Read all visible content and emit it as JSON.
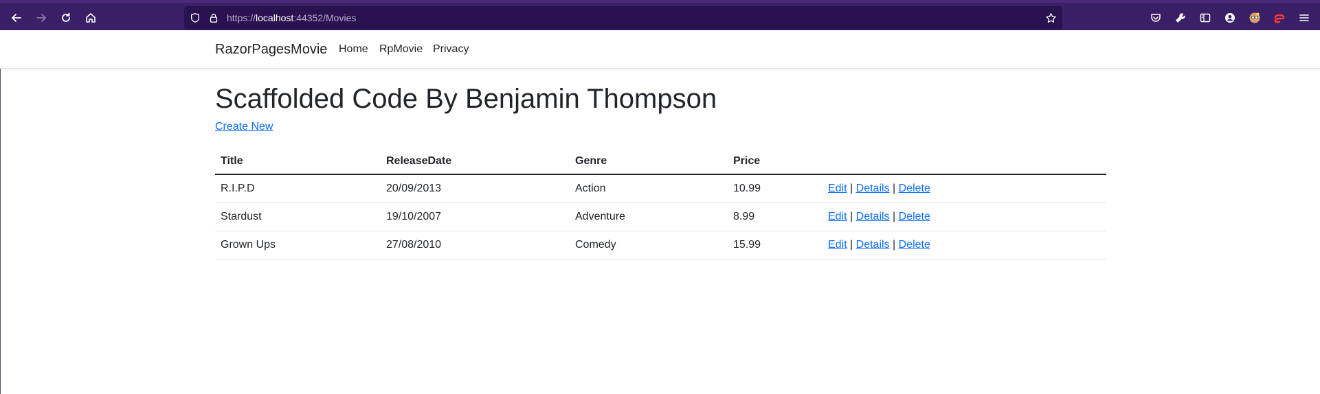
{
  "browser": {
    "url_prefix": "https://",
    "url_host": "localhost",
    "url_path": ":44352/Movies"
  },
  "navbar": {
    "brand": "RazorPagesMovie",
    "links": [
      "Home",
      "RpMovie",
      "Privacy"
    ]
  },
  "main": {
    "heading": "Scaffolded Code By Benjamin Thompson",
    "create_link": "Create New",
    "table": {
      "headers": [
        "Title",
        "ReleaseDate",
        "Genre",
        "Price"
      ],
      "rows": [
        {
          "title": "R.I.P.D",
          "release_date": "20/09/2013",
          "genre": "Action",
          "price": "10.99"
        },
        {
          "title": "Stardust",
          "release_date": "19/10/2007",
          "genre": "Adventure",
          "price": "8.99"
        },
        {
          "title": "Grown Ups",
          "release_date": "27/08/2010",
          "genre": "Comedy",
          "price": "15.99"
        }
      ],
      "actions": {
        "edit": "Edit",
        "details": "Details",
        "delete": "Delete",
        "separator": "|"
      }
    }
  },
  "colors": {
    "toolbar_bg": "#3b1f66",
    "urlbar_bg": "#2a114f",
    "link": "#0d6efd",
    "text": "#212529"
  }
}
